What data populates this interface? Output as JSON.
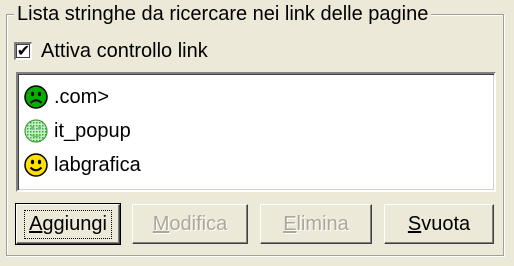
{
  "group": {
    "title": "Lista stringhe da ricercare nei link delle pagine"
  },
  "checkbox": {
    "label": "Attiva controllo link",
    "checked": true,
    "mark": "✔"
  },
  "list": {
    "items": [
      {
        "text": ".com>",
        "icon": "sad-face-icon",
        "color": "#00b000"
      },
      {
        "text": "it_popup",
        "icon": "dotted-face-icon",
        "color": "#60c060"
      },
      {
        "text": "labgrafica",
        "icon": "smiley-face-icon",
        "color": "#ffe000"
      }
    ]
  },
  "buttons": {
    "add": {
      "accel": "A",
      "rest": "ggiungi"
    },
    "edit": {
      "accel": "M",
      "rest": "odifica",
      "disabled": true
    },
    "delete": {
      "accel": "E",
      "rest": "limina",
      "disabled": true
    },
    "clear": {
      "accel": "S",
      "rest": "vuota"
    }
  },
  "colors": {
    "face": "#ece9d8",
    "disabled_text": "#aca899"
  }
}
